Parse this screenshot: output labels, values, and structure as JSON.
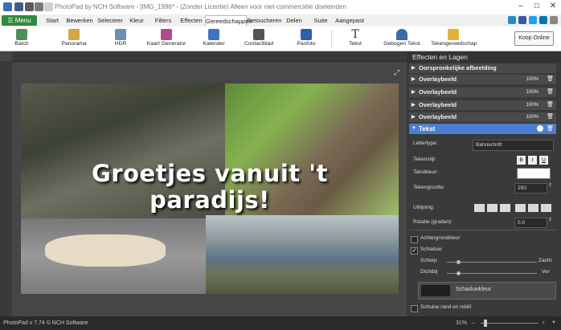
{
  "window": {
    "title": "PhotoPad by NCH Software - [IMG_1996* - (Zonder Licentie) Alleen voor niet-commerciële doeleinden",
    "controls": [
      "–",
      "□",
      "✕"
    ]
  },
  "menu": {
    "menu_button": "Menu",
    "tabs": [
      "Start",
      "Bewerken",
      "Selecteer",
      "Kleur",
      "Filters",
      "Effecten",
      "Gereedschappen",
      "Retoucheren",
      "Delen",
      "Suite",
      "Aangepast"
    ],
    "active_tab": "Gereedschappen"
  },
  "toolbar": {
    "tools": [
      "Batch",
      "Panorama",
      "HDR",
      "Kaart Generator",
      "Kalender",
      "Contactblad",
      "Pasfoto",
      "Tekst",
      "Gebogen Tekst",
      "Tekengereedschap"
    ],
    "buy_button": "Koop Online"
  },
  "canvas": {
    "headline": "Groetjes vanuit 't\nparadijs!"
  },
  "panel": {
    "title": "Effecten en Lagen",
    "layers": [
      {
        "name": "Oorspronkelijke afbeelding",
        "opacity": ""
      },
      {
        "name": "Overlaybeeld",
        "opacity": "100%"
      },
      {
        "name": "Overlaybeeld",
        "opacity": "100%"
      },
      {
        "name": "Overlaybeeld",
        "opacity": "100%"
      },
      {
        "name": "Overlaybeeld",
        "opacity": "100%"
      }
    ],
    "text_layer": {
      "name": "Tekst",
      "font_label": "Lettertype:",
      "font_value": "Bahnschrift",
      "style_label": "Tekenstijl:",
      "style_buttons": [
        "B",
        "I",
        "U"
      ],
      "color_label": "Tekstkleur:",
      "size_label": "Tekengrootte:",
      "size_value": "250",
      "align_label": "Uitlijning:",
      "rotation_label": "Rotatie (graden):",
      "rotation_value": "0.0",
      "background_color_label": "Achtergrondkleur",
      "shadow_label": "Schaduw",
      "shadow_enabled": true,
      "sharp_label": "Scherp",
      "soft_label": "Zacht",
      "near_label": "Dichtbij",
      "far_label": "Ver",
      "shadow_color_button": "Schaduwkleur",
      "emboss_label": "Schuine rand en reliëf"
    }
  },
  "status": {
    "version": "PhotoPad v 7.74 © NCH Software",
    "zoom": "31%"
  }
}
